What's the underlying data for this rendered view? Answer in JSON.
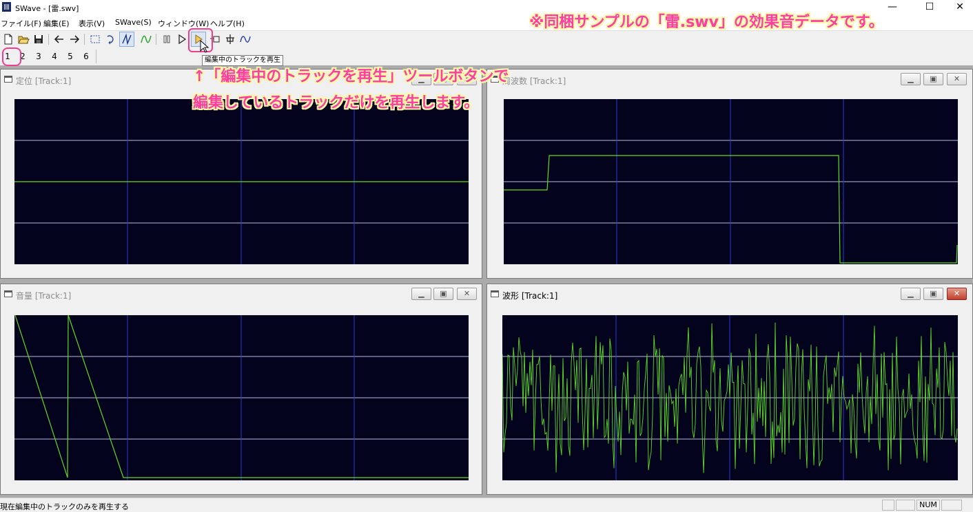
{
  "window": {
    "title": "SWave - [雷.swv]",
    "minimize": "—",
    "maximize": "☐",
    "close": "✕"
  },
  "menu": [
    "ファイル(F)",
    "編集(E)",
    "表示(V)",
    "SWave(S)",
    "ウィンドウ(W)",
    "ヘルプ(H)"
  ],
  "toolbar": {
    "buttons": [
      "new-file",
      "open-file",
      "save",
      "undo",
      "redo",
      "select",
      "loop",
      "line-draw",
      "curve-draw",
      "pause",
      "play",
      "play-track",
      "snap",
      "cross",
      "sine-wave"
    ],
    "active": "play-track",
    "tooltip": "編集中のトラックを再生"
  },
  "tracks": {
    "tabs": [
      "1",
      "2",
      "3",
      "4",
      "5",
      "6"
    ],
    "selected": "1"
  },
  "windows": [
    {
      "title": "定位 [Track:1]",
      "id": "pan",
      "active": false
    },
    {
      "title": "周波数 [Track:1]",
      "id": "frequency",
      "active": false
    },
    {
      "title": "音量 [Track:1]",
      "id": "volume",
      "active": false
    },
    {
      "title": "波形 [Track:1]",
      "id": "waveform",
      "active": true
    }
  ],
  "status": {
    "text": "現在編集中のトラックのみを再生する",
    "panels": [
      "",
      "",
      "NUM",
      ""
    ]
  },
  "annotations": {
    "top_right": "※同梱サンプルの「雷.swv」の効果音データです。",
    "line1": "↑「編集中のトラックを再生」ツールボタンで",
    "line2": "編集しているトラックだけを再生します。"
  },
  "colors": {
    "plot_bg": "#04031e",
    "trace": "#5fdc2a",
    "grid_h": "#b9b9dc",
    "grid_v": "#2a3ad2",
    "annotation": "#ff3ea5",
    "annotation_outline": "#fff8a8",
    "highlight": "#ee3e8f"
  }
}
